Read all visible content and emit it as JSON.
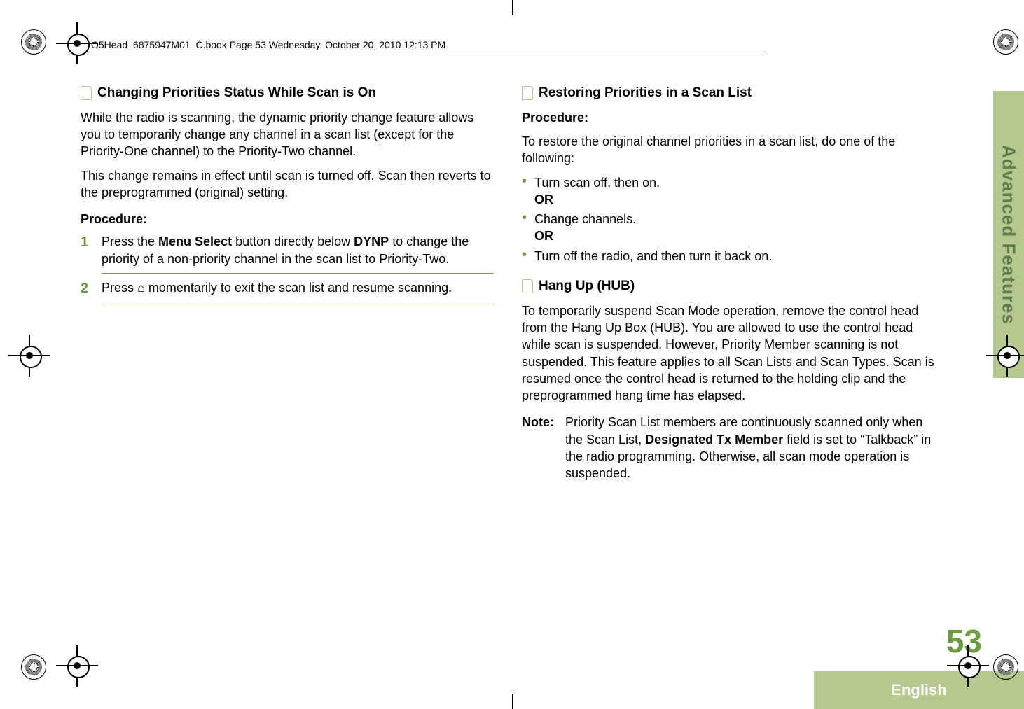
{
  "header": {
    "stamp": "O5Head_6875947M01_C.book  Page 53  Wednesday, October 20, 2010  12:13 PM"
  },
  "left": {
    "h1": "Changing Priorities Status While Scan is On",
    "p1": "While the radio is scanning, the dynamic priority change feature allows you to temporarily change any channel in a scan list (except for the Priority-One channel) to the Priority-Two channel.",
    "p2": "This change remains in effect until scan is turned off. Scan then reverts to the preprogrammed (original) setting.",
    "procedure_label": "Procedure:",
    "step1_num": "1",
    "step1_a": "Press the ",
    "step1_b": "Menu Select",
    "step1_c": " button directly below ",
    "step1_dynp": "DYNP",
    "step1_d": " to change the priority of a non-priority channel in the scan list to Priority-Two.",
    "step2_num": "2",
    "step2_a": "Press ",
    "step2_icon": "⌂",
    "step2_b": " momentarily to exit the scan list and resume scanning."
  },
  "right": {
    "h1": "Restoring Priorities in a Scan List",
    "procedure_label": "Procedure:",
    "p1": "To restore the original channel priorities in a scan list, do one of the following:",
    "b1": "Turn scan off, then on.",
    "or": "OR",
    "b2": "Change channels.",
    "b3": "Turn off the radio, and then turn it back on.",
    "h2": "Hang Up (HUB)",
    "p2": "To temporarily suspend Scan Mode operation, remove the control head from the Hang Up Box (HUB). You are allowed to use the control head while scan is suspended. However, Priority Member scanning is not suspended. This feature applies to all Scan Lists and Scan Types. Scan is resumed once the control head is returned to the holding clip and the preprogrammed hang time has elapsed.",
    "note_label": "Note:",
    "note_a": "Priority Scan List members are continuously scanned only when the Scan List, ",
    "note_b": "Designated Tx Member",
    "note_c": " field is set to “Talkback” in the radio programming. Otherwise, all scan mode operation is suspended."
  },
  "sidebar": {
    "section": "Advanced Features",
    "page": "53",
    "lang": "English"
  }
}
